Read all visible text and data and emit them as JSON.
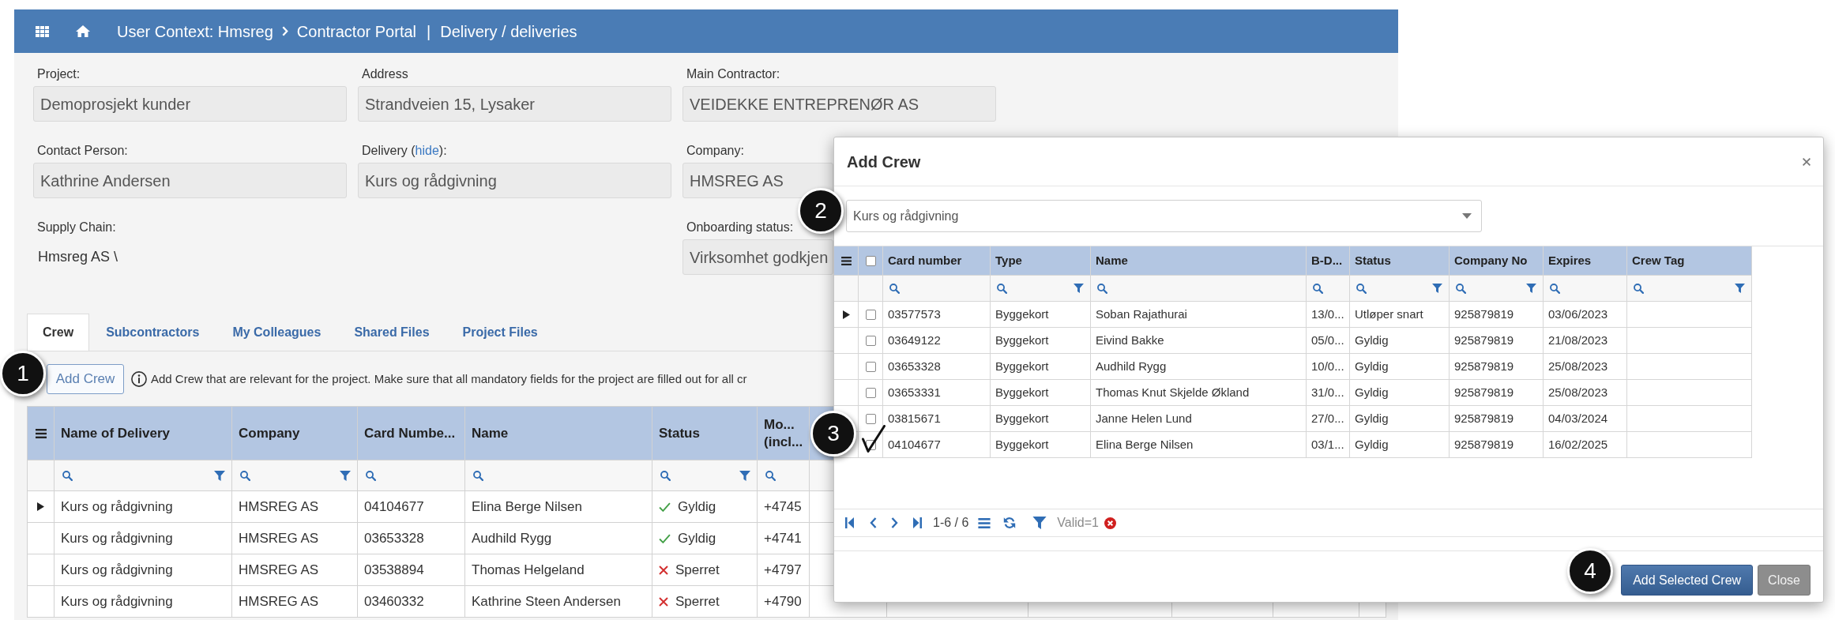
{
  "header": {
    "context": "User Context: Hmsreg",
    "portal": "Contractor Portal",
    "separator": "|",
    "page": "Delivery / deliveries"
  },
  "form": {
    "columns": [
      {
        "fields": [
          {
            "kind": "box",
            "label": "Project:",
            "value": "Demoprosjekt kunder"
          },
          {
            "kind": "box",
            "label": "Contact Person:",
            "value": "Kathrine Andersen"
          },
          {
            "kind": "text",
            "label": "Supply Chain:",
            "value": "Hmsreg AS \\"
          }
        ]
      },
      {
        "fields": [
          {
            "kind": "box",
            "label": "Address",
            "value": "Strandveien 15, Lysaker"
          },
          {
            "kind": "box",
            "label": "Delivery (",
            "link": "hide",
            "label_end": "):",
            "value": "Kurs og rådgivning"
          }
        ]
      },
      {
        "fields": [
          {
            "kind": "box",
            "label": "Main Contractor:",
            "value": "VEIDEKKE ENTREPRENØR AS"
          },
          {
            "kind": "box",
            "label": "Company:",
            "value": "HMSREG AS"
          },
          {
            "kind": "box",
            "label": "Onboarding status:",
            "value": "Virksomhet godkjen"
          }
        ]
      }
    ]
  },
  "tabs": [
    {
      "label": "Crew",
      "selected": true
    },
    {
      "label": "Subcontractors",
      "selected": false
    },
    {
      "label": "My Colleagues",
      "selected": false
    },
    {
      "label": "Shared Files",
      "selected": false
    },
    {
      "label": "Project Files",
      "selected": false
    }
  ],
  "toolbar": {
    "button": "Add Crew",
    "info": "Add Crew that are relevant for the project. Make sure that all mandatory fields for the project are filled out for all cr"
  },
  "crew_table": {
    "columns": [
      {
        "label": "Name of Delivery",
        "filter": true
      },
      {
        "label": "Company",
        "filter": true
      },
      {
        "label": "Card Numbe...",
        "filter": false
      },
      {
        "label": "Name",
        "filter": false
      },
      {
        "label": "Status",
        "filter": true
      },
      {
        "label": "Mo... (incl...",
        "filter": false
      }
    ],
    "rows": [
      {
        "current": true,
        "cells": [
          {
            "kind": "text",
            "text": "Kurs og rådgivning"
          },
          {
            "kind": "text",
            "text": "HMSREG AS"
          },
          {
            "kind": "text",
            "text": "04104677"
          },
          {
            "kind": "text",
            "text": "Elina Berge Nilsen"
          },
          {
            "kind": "valid",
            "text": "Gyldig"
          },
          {
            "kind": "text",
            "text": "+4745"
          }
        ]
      },
      {
        "current": false,
        "cells": [
          {
            "kind": "text",
            "text": "Kurs og rådgivning"
          },
          {
            "kind": "text",
            "text": "HMSREG AS"
          },
          {
            "kind": "text",
            "text": "03653328"
          },
          {
            "kind": "text",
            "text": "Audhild Rygg"
          },
          {
            "kind": "valid",
            "text": "Gyldig"
          },
          {
            "kind": "text",
            "text": "+4741"
          }
        ]
      },
      {
        "current": false,
        "cells": [
          {
            "kind": "text",
            "text": "Kurs og rådgivning"
          },
          {
            "kind": "text",
            "text": "HMSREG AS"
          },
          {
            "kind": "text",
            "text": "03538894"
          },
          {
            "kind": "text",
            "text": "Thomas Helgeland"
          },
          {
            "kind": "blocked",
            "text": "Sperret"
          },
          {
            "kind": "text",
            "text": "+4797"
          }
        ]
      },
      {
        "current": false,
        "cells": [
          {
            "kind": "text",
            "text": "Kurs og rådgivning"
          },
          {
            "kind": "text",
            "text": "HMSREG AS"
          },
          {
            "kind": "text",
            "text": "03460332"
          },
          {
            "kind": "text",
            "text": "Kathrine Steen Andersen"
          },
          {
            "kind": "blocked",
            "text": "Sperret"
          },
          {
            "kind": "text",
            "text": "+4790"
          }
        ]
      }
    ]
  },
  "dialog": {
    "title": "Add Crew",
    "delivery_select": {
      "value": "Kurs og rådgivning"
    },
    "table": {
      "select_all": {
        "checked": false
      },
      "columns": [
        {
          "label": "Card number",
          "filter": false
        },
        {
          "label": "Type",
          "filter": true
        },
        {
          "label": "Name",
          "filter": false
        },
        {
          "label": "B-D...",
          "filter": false
        },
        {
          "label": "Status",
          "filter": true
        },
        {
          "label": "Company No",
          "filter": true
        },
        {
          "label": "Expires",
          "filter": false
        },
        {
          "label": "Crew Tag",
          "filter": true
        }
      ],
      "rows": [
        {
          "current": true,
          "checked": false,
          "cells": [
            "03577573",
            "Byggekort",
            "Soban Rajathurai",
            "13/0...",
            "Utløper snart",
            "925879819",
            "03/06/2023"
          ]
        },
        {
          "current": false,
          "checked": false,
          "cells": [
            "03649122",
            "Byggekort",
            "Eivind Bakke",
            "05/0...",
            "Gyldig",
            "925879819",
            "21/08/2023"
          ]
        },
        {
          "current": false,
          "checked": false,
          "cells": [
            "03653328",
            "Byggekort",
            "Audhild Rygg",
            "10/0...",
            "Gyldig",
            "925879819",
            "25/08/2023"
          ]
        },
        {
          "current": false,
          "checked": false,
          "cells": [
            "03653331",
            "Byggekort",
            "Thomas Knut Skjelde Økland",
            "31/0...",
            "Gyldig",
            "925879819",
            "25/08/2023"
          ]
        },
        {
          "current": false,
          "checked": false,
          "cells": [
            "03815671",
            "Byggekort",
            "Janne Helen Lund",
            "27/0...",
            "Gyldig",
            "925879819",
            "04/03/2024"
          ]
        },
        {
          "current": false,
          "checked": true,
          "cells": [
            "04104677",
            "Byggekort",
            "Elina Berge Nilsen",
            "03/1...",
            "Gyldig",
            "925879819",
            "16/02/2025"
          ]
        }
      ]
    },
    "pager": {
      "range": "1-6 / 6",
      "filter_text": "Valid=1"
    },
    "buttons": [
      {
        "label": "Add Selected Crew",
        "kind": "primary"
      },
      {
        "label": "Close",
        "kind": "secondary"
      }
    ]
  },
  "callouts": [
    {
      "number": "1"
    },
    {
      "number": "2"
    },
    {
      "number": "3"
    },
    {
      "number": "4"
    }
  ]
}
